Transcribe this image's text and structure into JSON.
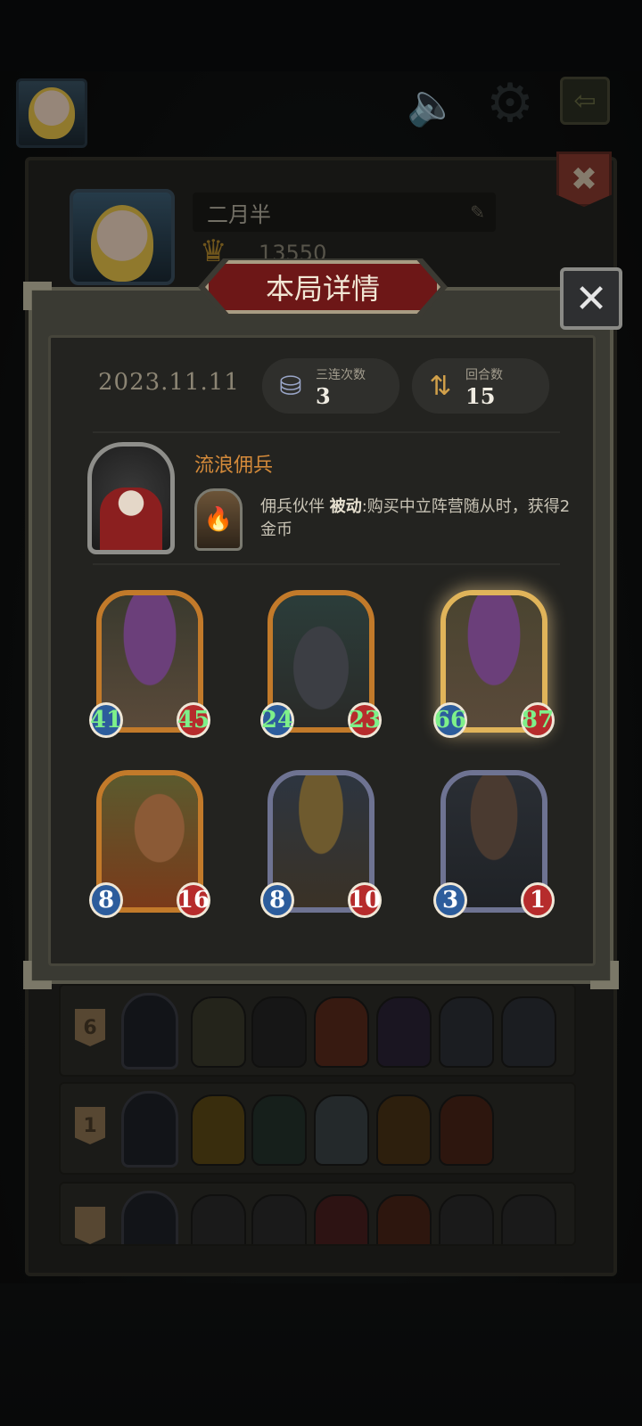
{
  "background": {
    "player_name": "二月半",
    "score": "13550",
    "rows": [
      {
        "rank": "6"
      },
      {
        "rank": "1"
      },
      {
        "rank": ""
      }
    ]
  },
  "dialog": {
    "title": "本局详情",
    "date": "2023.11.11",
    "stats": [
      {
        "label": "三连次数",
        "value": "3",
        "icon": "triple-units-icon"
      },
      {
        "label": "回合数",
        "value": "15",
        "icon": "round-arrows-icon"
      }
    ],
    "hero": {
      "name": "流浪佣兵",
      "skill_prefix": "佣兵伙伴 ",
      "skill_keyword": "被动",
      "skill_desc": ":购买中立阵营随从时，获得2金币"
    },
    "minions": [
      {
        "name": "mushroom",
        "attack": "41",
        "health": "45",
        "frame": "gold",
        "buffed": true,
        "golden": false
      },
      {
        "name": "panther",
        "attack": "24",
        "health": "23",
        "frame": "gold",
        "buffed": true,
        "golden": false
      },
      {
        "name": "mushroom-golden",
        "attack": "66",
        "health": "87",
        "frame": "gold",
        "buffed": true,
        "golden": true
      },
      {
        "name": "flower-girl",
        "attack": "8",
        "health": "16",
        "frame": "gold",
        "buffed": false,
        "golden": false
      },
      {
        "name": "witch",
        "attack": "8",
        "health": "10",
        "frame": "silver",
        "buffed": false,
        "golden": false
      },
      {
        "name": "box-golem",
        "attack": "3",
        "health": "1",
        "frame": "silver",
        "buffed": false,
        "golden": false
      }
    ]
  },
  "colors": {
    "accent_red": "#6d1717",
    "hero_name": "#d48a3a",
    "buffed_stat": "#7ef08a"
  }
}
